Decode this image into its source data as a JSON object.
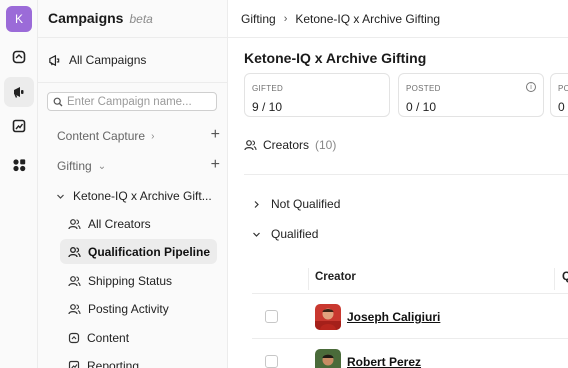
{
  "rail": {
    "avatar_letter": "K",
    "icons": [
      "box-icon",
      "megaphone-icon",
      "chart-icon",
      "apps-icon"
    ]
  },
  "sidebar": {
    "title": "Campaigns",
    "beta": "beta",
    "all_campaigns": "All Campaigns",
    "search_placeholder": "Enter Campaign name...",
    "sections": [
      {
        "label": "Content Capture",
        "chevron": "›"
      },
      {
        "label": "Gifting",
        "chevron": "⌄"
      }
    ],
    "campaign": "Ketone-IQ x Archive Gift...",
    "items": [
      {
        "label": "All Creators"
      },
      {
        "label": "Qualification Pipeline"
      },
      {
        "label": "Shipping Status"
      },
      {
        "label": "Posting Activity"
      },
      {
        "label": "Content"
      },
      {
        "label": "Reporting"
      }
    ]
  },
  "main": {
    "breadcrumb": {
      "root": "Gifting",
      "sep": "›",
      "current": "Ketone-IQ x Archive Gifting"
    },
    "title": "Ketone-IQ x Archive Gifting",
    "stats": [
      {
        "label": "GIFTED",
        "value": "9 / 10"
      },
      {
        "label": "POSTED",
        "value": "0 / 10"
      },
      {
        "label": "PO",
        "value": "0"
      }
    ],
    "creators_label": "Creators",
    "creators_count": "(10)",
    "groups": [
      {
        "label": "Not Qualified",
        "caret": "›"
      },
      {
        "label": "Qualified",
        "caret": "⌄"
      }
    ],
    "table": {
      "col_creator": "Creator",
      "col_next": "Q",
      "rows": [
        {
          "name": "Joseph Caligiuri"
        },
        {
          "name": "Robert Perez"
        }
      ]
    }
  },
  "colors": {
    "avatar_bg": "#9b6bd8",
    "accent_text": "#1a1a1a",
    "muted": "#888888"
  }
}
